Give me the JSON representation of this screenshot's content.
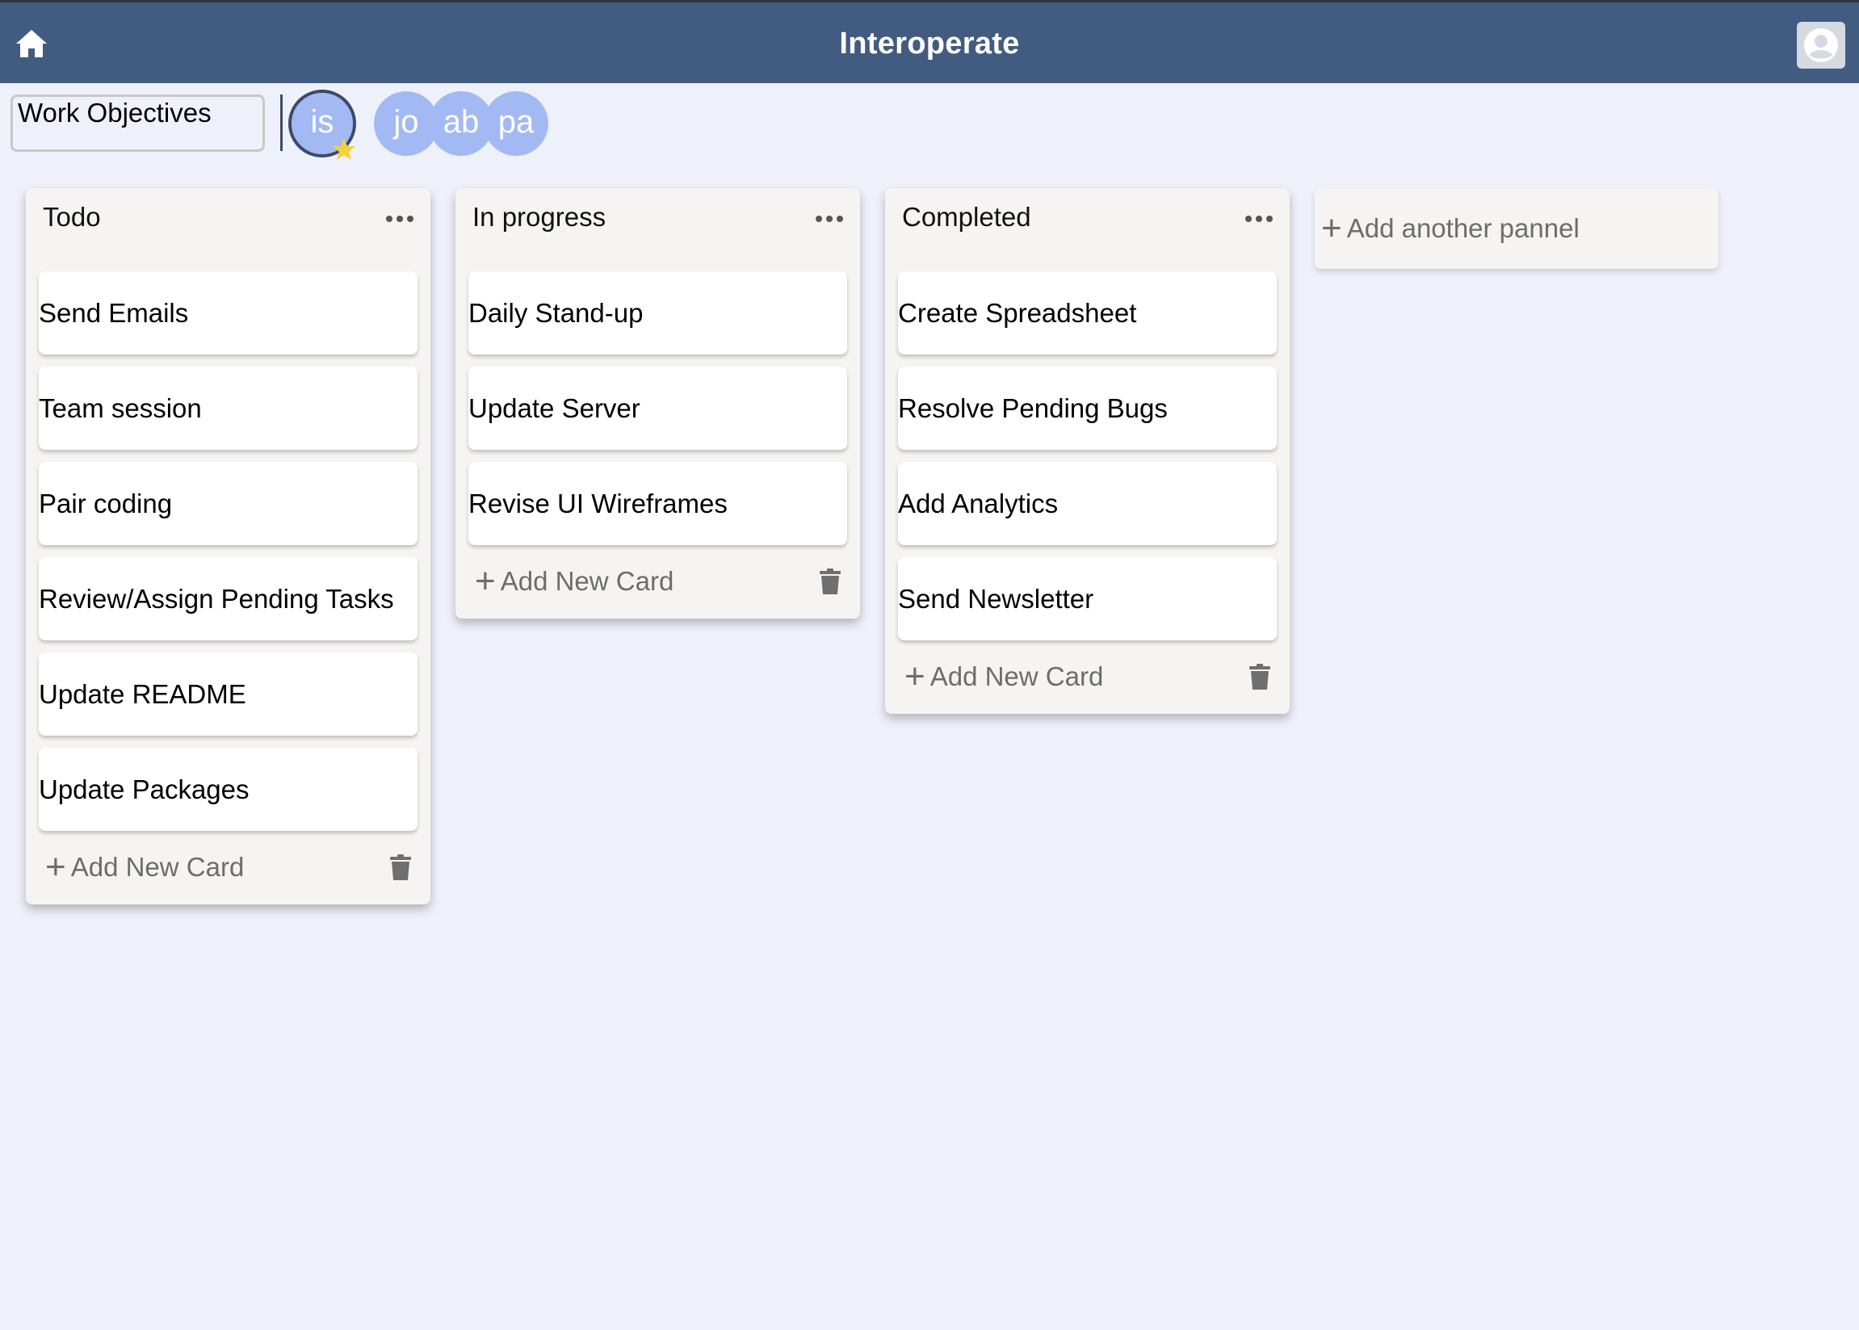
{
  "header": {
    "title": "Interoperate",
    "home_icon": "home-icon",
    "user_icon": "user-circle-icon",
    "bar_color": "#425b80"
  },
  "board": {
    "title": "Work Objectives",
    "members": [
      {
        "initials": "is",
        "owner": true
      },
      {
        "initials": "jo",
        "owner": false
      },
      {
        "initials": "ab",
        "owner": false
      },
      {
        "initials": "pa",
        "owner": false
      }
    ]
  },
  "panels": [
    {
      "title": "Todo",
      "cards": [
        "Send Emails",
        "Team session",
        "Pair coding",
        "Review/Assign Pending Tasks",
        "Update README",
        "Update Packages"
      ],
      "add_label": "Add New Card"
    },
    {
      "title": "In progress",
      "cards": [
        "Daily Stand-up",
        "Update Server",
        "Revise UI Wireframes"
      ],
      "add_label": "Add New Card"
    },
    {
      "title": "Completed",
      "cards": [
        "Create Spreadsheet",
        "Resolve Pending Bugs",
        "Add Analytics",
        "Send Newsletter"
      ],
      "add_label": "Add New Card"
    }
  ],
  "add_panel_label": "Add another pannel",
  "plus_symbol": "+"
}
